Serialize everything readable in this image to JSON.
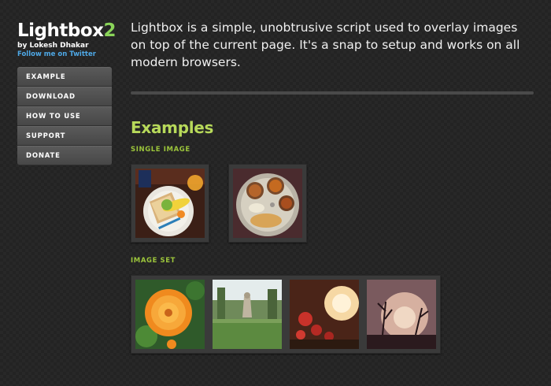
{
  "brand": {
    "name": "Lightbox",
    "version": "2",
    "byline": "by Lokesh Dhakar",
    "twitter_link": "Follow me on Twitter"
  },
  "nav": {
    "items": [
      {
        "label": "EXAMPLE"
      },
      {
        "label": "DOWNLOAD"
      },
      {
        "label": "HOW TO USE"
      },
      {
        "label": "SUPPORT"
      },
      {
        "label": "DONATE"
      }
    ]
  },
  "intro": "Lightbox is a simple, unobtrusive script used to overlay images on top of the current page. It's a snap to setup and works on all modern browsers.",
  "examples": {
    "title": "Examples",
    "single_image_label": "SINGLE IMAGE",
    "image_set_label": "IMAGE SET"
  },
  "colors": {
    "accent_green": "#b7d95a",
    "sub_green": "#9cc53b",
    "link_blue": "#4ea8e6",
    "background": "#232323"
  }
}
